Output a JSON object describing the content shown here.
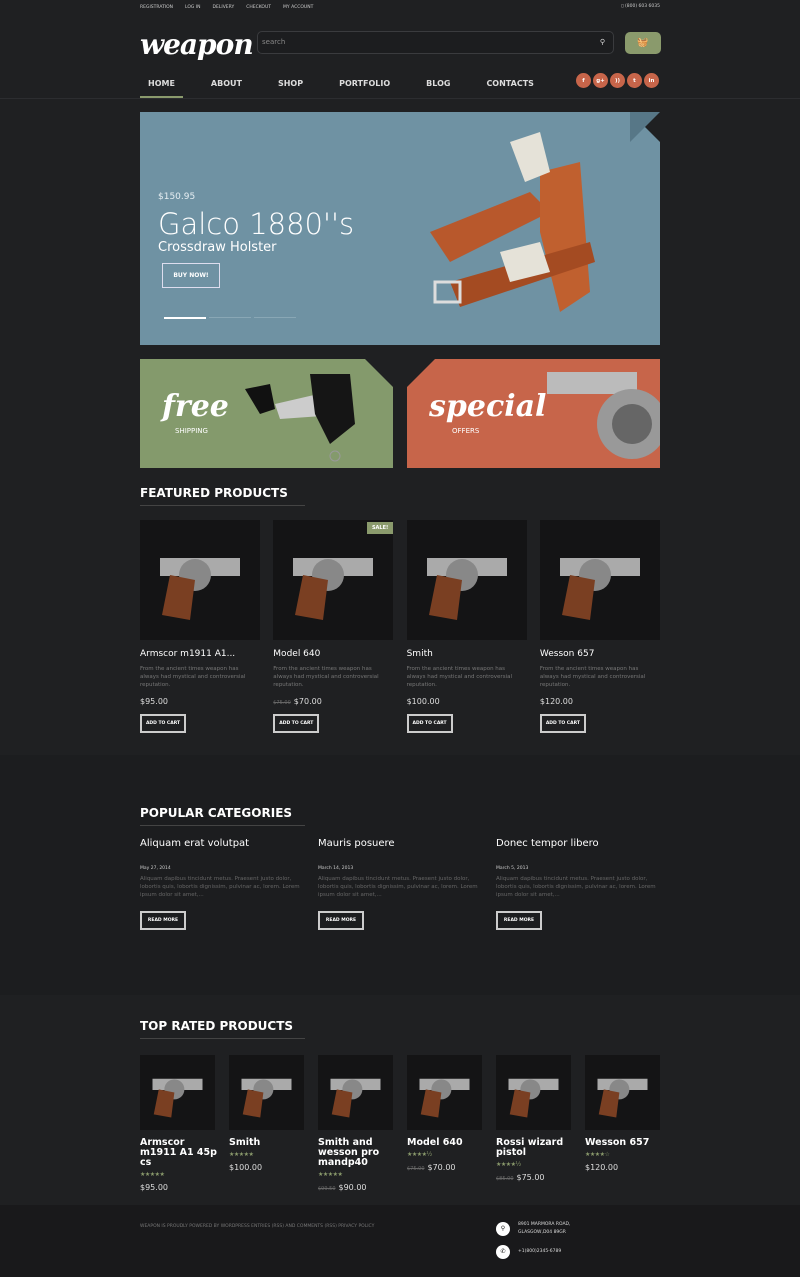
{
  "topbar": {
    "links": [
      "REGISTRATION",
      "LOG IN",
      "DELIVERY",
      "CHECKOUT",
      "MY ACCOUNT"
    ],
    "phone": "(800) 603 6035"
  },
  "header": {
    "logo": "weapon",
    "search_placeholder": "search",
    "cart_icon": "basket-icon"
  },
  "nav": [
    "HOME",
    "ABOUT",
    "SHOP",
    "PORTFOLIO",
    "BLOG",
    "CONTACTS"
  ],
  "social": [
    "f",
    "g+",
    "rss",
    "t",
    "in"
  ],
  "slider": {
    "price": "$150.95",
    "title": "Galco 1880''s",
    "subtitle": "Crossdraw Holster",
    "button": "BUY NOW!",
    "color": "#6f92a3"
  },
  "banners": [
    {
      "word": "free",
      "small": "SHIPPING",
      "color": "#849a6c"
    },
    {
      "word": "special",
      "small": "OFFERS",
      "color": "#c7654a"
    }
  ],
  "featured": {
    "title": "FEATURED PRODUCTS",
    "button": "ADD TO CART",
    "sale": "SALE!",
    "desc": "From the ancient times weapon has always had mystical and controversial reputation.",
    "items": [
      {
        "name": "Armscor m1911 A1...",
        "price": "$95.00",
        "old": ""
      },
      {
        "name": "Model 640",
        "price": "$70.00",
        "old": "$75.00"
      },
      {
        "name": "Smith",
        "price": "$100.00",
        "old": ""
      },
      {
        "name": "Wesson 657",
        "price": "$120.00",
        "old": ""
      }
    ]
  },
  "popular": {
    "title": "POPULAR CATEGORIES",
    "button": "READ MORE",
    "text": "Aliquam dapibus tincidunt metus. Praesent justo dolor, lobortis quis, lobortis dignissim, pulvinar ac, lorem. Lorem ipsum dolor sit amet,...",
    "posts": [
      {
        "title": "Aliquam erat volutpat",
        "date": "May 27, 2014"
      },
      {
        "title": "Mauris posuere",
        "date": "March 14, 2013"
      },
      {
        "title": "Donec tempor libero",
        "date": "March 5, 2013"
      }
    ]
  },
  "top_rated": {
    "title": "TOP RATED PRODUCTS",
    "items": [
      {
        "name": "Armscor m1911 A1 45p cs",
        "rating": 5,
        "stars": "★★★★★",
        "price": "$95.00",
        "old": ""
      },
      {
        "name": "Smith",
        "rating": 5,
        "stars": "★★★★★",
        "price": "$100.00",
        "old": ""
      },
      {
        "name": "Smith and wesson pro mandp40",
        "rating": 5,
        "stars": "★★★★★",
        "price": "$90.00",
        "old": "$99.50"
      },
      {
        "name": "Model 640",
        "rating": 4.5,
        "stars": "★★★★½",
        "price": "$70.00",
        "old": "$75.00"
      },
      {
        "name": "Rossi wizard pistol",
        "rating": 4.5,
        "stars": "★★★★½",
        "price": "$75.00",
        "old": "$85.00"
      },
      {
        "name": "Wesson 657",
        "rating": 4,
        "stars": "★★★★☆",
        "price": "$120.00",
        "old": ""
      }
    ]
  },
  "footer": {
    "text": "WEAPON IS PROUDLY POWERED BY WORDPRESS ENTRIES (RSS) AND COMMENTS (RSS) PRIVACY POLICY",
    "address1": "8901 MARMORA ROAD,",
    "address2": "GLASGOW,D04 89GR",
    "phone": "+1(800)2345-6789"
  }
}
